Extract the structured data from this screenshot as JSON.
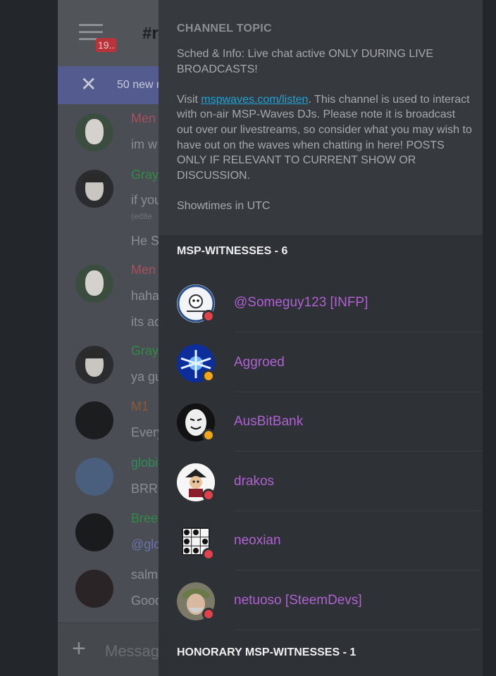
{
  "chat": {
    "badge": "19..",
    "channel": "#r",
    "new_messages": "50 new m",
    "messages": [
      {
        "user": "Men",
        "user_color": "#a3525f",
        "lines": [
          "im w"
        ]
      },
      {
        "user": "Gray",
        "user_color": "#2f8b45",
        "lines": [
          "if you",
          "(edite",
          "He Sc"
        ]
      },
      {
        "user": "Men",
        "user_color": "#a3525f",
        "lines": [
          "haha",
          "its ac"
        ]
      },
      {
        "user": "Gray",
        "user_color": "#2f8b45",
        "lines": [
          "ya gu"
        ]
      },
      {
        "user": "M1",
        "user_color": "#8a5a3f",
        "lines": [
          "Every"
        ]
      },
      {
        "user": "globi",
        "user_color": "#2f8b5a",
        "lines": [
          "BRRR"
        ]
      },
      {
        "user": "Bree",
        "user_color": "#2f8b45",
        "lines": [
          "@glo"
        ]
      },
      {
        "user": "",
        "user_color": "#8a8d92",
        "lines": [
          "salm",
          "Good"
        ]
      }
    ],
    "input_placeholder": "Message"
  },
  "drawer": {
    "topic_heading": "CHANNEL TOPIC",
    "topic_line1": "Sched & Info: Live chat active ONLY DURING LIVE BROADCASTS!",
    "topic_visit": "Visit ",
    "topic_link": "mspwaves.com/listen",
    "topic_rest": ". This channel is used to interact with on-air MSP-Waves DJs. Please note it is broadcast out over our livestreams, so consider what you may wish to have out on the waves when chatting in here! POSTS ONLY IF RELEVANT TO CURRENT SHOW OR DISCUSSION.",
    "topic_showtimes": "Showtimes in UTC",
    "group1": "MSP-WITNESSES - 6",
    "members": [
      {
        "name": "@Someguy123 [INFP]",
        "status": "dnd",
        "status_color": "#e0424c"
      },
      {
        "name": "Aggroed",
        "status": "idle",
        "status_color": "#f0a51c"
      },
      {
        "name": "AusBitBank",
        "status": "idle",
        "status_color": "#f0a51c"
      },
      {
        "name": "drakos",
        "status": "dnd",
        "status_color": "#e0424c"
      },
      {
        "name": "neoxian",
        "status": "dnd",
        "status_color": "#e0424c"
      },
      {
        "name": "netuoso [SteemDevs]",
        "status": "dnd",
        "status_color": "#e0424c"
      }
    ],
    "group2": "HONORARY MSP-WITNESSES - 1"
  }
}
